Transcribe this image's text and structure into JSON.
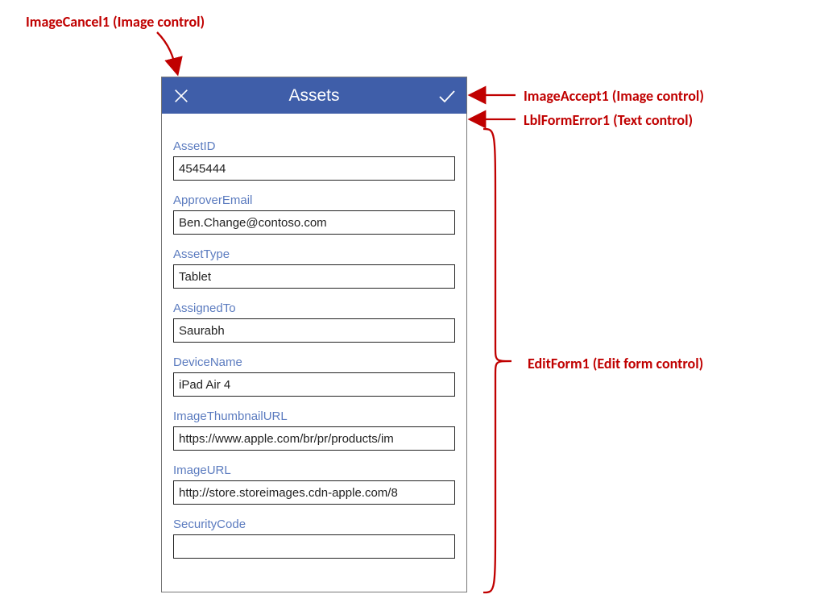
{
  "header": {
    "title": "Assets"
  },
  "fields": {
    "asset_id": {
      "label": "AssetID",
      "value": "4545444"
    },
    "approver_email": {
      "label": "ApproverEmail",
      "value": "Ben.Change@contoso.com"
    },
    "asset_type": {
      "label": "AssetType",
      "value": "Tablet"
    },
    "assigned_to": {
      "label": "AssignedTo",
      "value": "Saurabh"
    },
    "device_name": {
      "label": "DeviceName",
      "value": "iPad Air 4"
    },
    "thumb_url": {
      "label": "ImageThumbnailURL",
      "value": "https://www.apple.com/br/pr/products/im"
    },
    "image_url": {
      "label": "ImageURL",
      "value": "http://store.storeimages.cdn-apple.com/8"
    },
    "security_code": {
      "label": "SecurityCode",
      "value": ""
    }
  },
  "annotations": {
    "cancel": "ImageCancel1 (Image control)",
    "accept": "ImageAccept1 (Image control)",
    "error": "LblFormError1 (Text control)",
    "form": "EditForm1 (Edit form control)"
  }
}
